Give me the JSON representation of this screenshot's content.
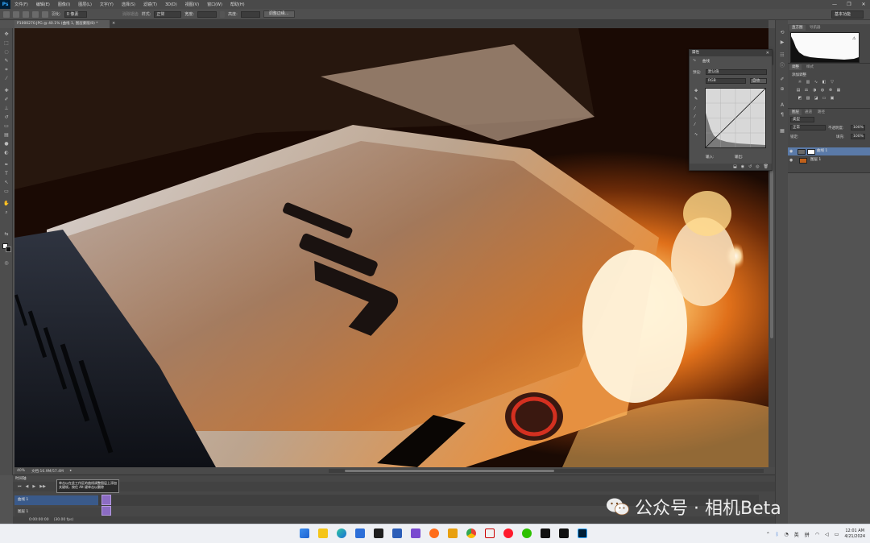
{
  "app": {
    "logo": "Ps",
    "menu": [
      "文件(F)",
      "编辑(E)",
      "图像(I)",
      "图层(L)",
      "文字(Y)",
      "选择(S)",
      "滤镜(T)",
      "3D(D)",
      "视图(V)",
      "窗口(W)",
      "帮助(H)"
    ],
    "window_controls": [
      "minimize",
      "restore",
      "close"
    ]
  },
  "options_bar": {
    "width_label": "羽化:",
    "width_value": "0 像素",
    "antialias": "消除锯齿",
    "style_label": "样式:",
    "style_value": "正常",
    "w_label": "宽度:",
    "h_label": "高度:",
    "refine_button": "调整边缘...",
    "workspace": "基本功能"
  },
  "document": {
    "tab_title": "P1000270.JPG @ 40.1% (曲线 1, 图层蒙版/8) *",
    "zoom": "40%",
    "doc_info": "文档:16.9M/57.4M"
  },
  "timeline": {
    "title": "时间轴",
    "tooltip": "单击以在此工作区的曲线调整图层上添加关键帧，按住 Alt 键单击以删除",
    "tracks": [
      "曲线 1",
      "图层 1"
    ],
    "time_start": "0:00:00:00",
    "fps": "(30.00 fps)"
  },
  "panels": {
    "histogram_tab": "直方图",
    "histogram_tab2": "导航器",
    "adjust_tab": "调整",
    "adjust_tab2": "样式",
    "adjust_hint": "添加调整",
    "layers_tab": "图层",
    "layers_tab2": "通道",
    "layers_tab3": "路径",
    "filter_kind": "类型",
    "blend_mode": "正常",
    "opacity_label": "不透明度:",
    "opacity_value": "100%",
    "lock_label": "锁定:",
    "fill_label": "填充:",
    "fill_value": "100%",
    "layers": [
      {
        "name": "曲线 1",
        "selected": true
      },
      {
        "name": "图层 1",
        "selected": false
      }
    ]
  },
  "properties": {
    "title": "属性",
    "subtitle": "曲线",
    "preset_label": "预设:",
    "preset_value": "默认值",
    "channel_value": "RGB",
    "auto_button": "自动",
    "input_label": "输入:",
    "output_label": "输出:"
  },
  "watermark": {
    "text": "公众号 · 相机Beta"
  },
  "taskbar": {
    "lang": "英",
    "ime": "拼",
    "time": "12:01 AM",
    "date": "4/21/2024"
  },
  "colors": {
    "accent": "#31a8ff",
    "selected_layer": "#5a7aa8",
    "clip": "#8c6cc4"
  }
}
